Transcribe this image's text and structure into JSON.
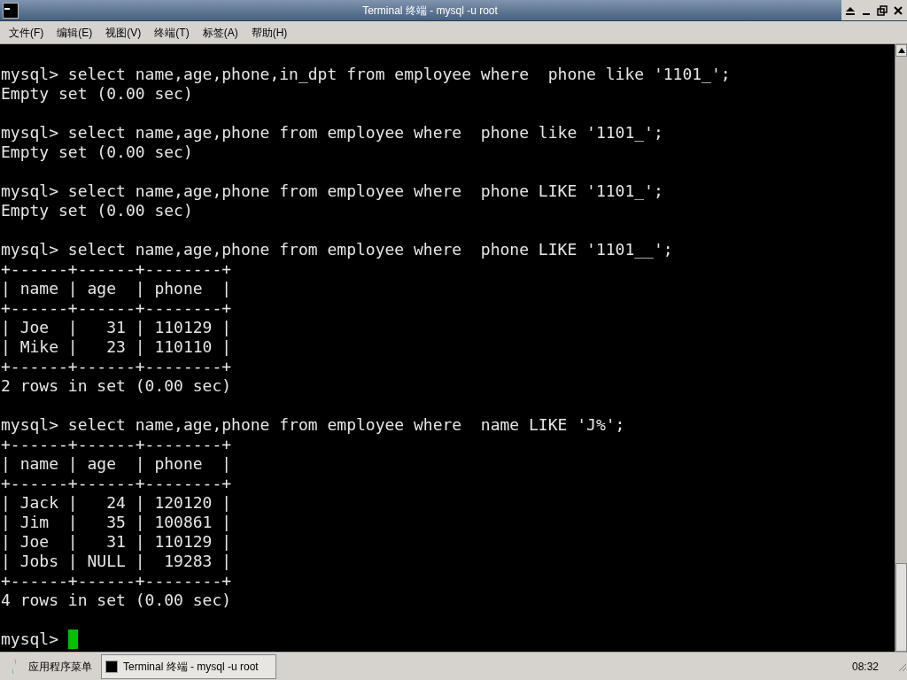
{
  "window": {
    "title": "Terminal 终端 - mysql -u root"
  },
  "menu": [
    "文件(F)",
    "编辑(E)",
    "视图(V)",
    "终端(T)",
    "标签(A)",
    "帮助(H)"
  ],
  "terminal": {
    "blocks": [
      {
        "prompt": "mysql>",
        "command": "select name,age,phone,in_dpt from employee where  phone like '1101_';",
        "output": [
          "Empty set (0.00 sec)"
        ]
      },
      {
        "prompt": "mysql>",
        "command": "select name,age,phone from employee where  phone like '1101_';",
        "output": [
          "Empty set (0.00 sec)"
        ]
      },
      {
        "prompt": "mysql>",
        "command": "select name,age,phone from employee where  phone LIKE '1101_';",
        "output": [
          "Empty set (0.00 sec)"
        ]
      },
      {
        "prompt": "mysql>",
        "command": "select name,age,phone from employee where  phone LIKE '1101__';",
        "output": [
          "+------+------+--------+",
          "| name | age  | phone  |",
          "+------+------+--------+",
          "| Joe  |   31 | 110129 |",
          "| Mike |   23 | 110110 |",
          "+------+------+--------+",
          "2 rows in set (0.00 sec)"
        ]
      },
      {
        "prompt": "mysql>",
        "command": "select name,age,phone from employee where  name LIKE 'J%';",
        "output": [
          "+------+------+--------+",
          "| name | age  | phone  |",
          "+------+------+--------+",
          "| Jack |   24 | 120120 |",
          "| Jim  |   35 | 100861 |",
          "| Joe  |   31 | 110129 |",
          "| Jobs | NULL |  19283 |",
          "+------+------+--------+",
          "4 rows in set (0.00 sec)"
        ]
      }
    ],
    "current_prompt": "mysql>"
  },
  "taskbar": {
    "start_menu": "应用程序菜单",
    "tasks": [
      {
        "label": "Terminal 终端 - mysql -u root",
        "selected": true
      }
    ],
    "clock": "08:32"
  }
}
